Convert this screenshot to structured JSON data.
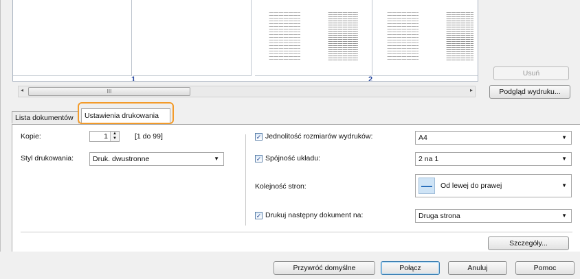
{
  "preview": {
    "page_numbers": [
      "1",
      "2"
    ],
    "scroll_thumb_glyph": "III",
    "scroll_left": "◂",
    "scroll_right": "▸"
  },
  "side_buttons": {
    "remove": "Usuń",
    "print_preview": "Podgląd wydruku..."
  },
  "tabs": [
    {
      "label": "Lista dokumentów"
    },
    {
      "label": "Ustawienia drukowania"
    }
  ],
  "left": {
    "copies_label": "Kopie:",
    "copies_value": "1",
    "copies_range": "[1 do 99]",
    "style_label": "Styl drukowania:",
    "style_value": "Druk. dwustronne"
  },
  "right": {
    "uniform_size_label": "Jednolitość rozmiarów wydruków:",
    "uniform_size_value": "A4",
    "layout_label": "Spójność układu:",
    "layout_value": "2 na 1",
    "page_order_label": "Kolejność stron:",
    "page_order_value": "Od lewej do prawej",
    "next_doc_label": "Drukuj następny dokument na:",
    "next_doc_value": "Druga strona",
    "check_mark": "✓"
  },
  "details_button": "Szczegóły...",
  "footer": {
    "restore": "Przywróć domyślne",
    "combine": "Połącz",
    "cancel": "Anuluj",
    "help": "Pomoc"
  },
  "colors": {
    "highlight": "#f39b2a",
    "page_number": "#2a4aa0"
  }
}
